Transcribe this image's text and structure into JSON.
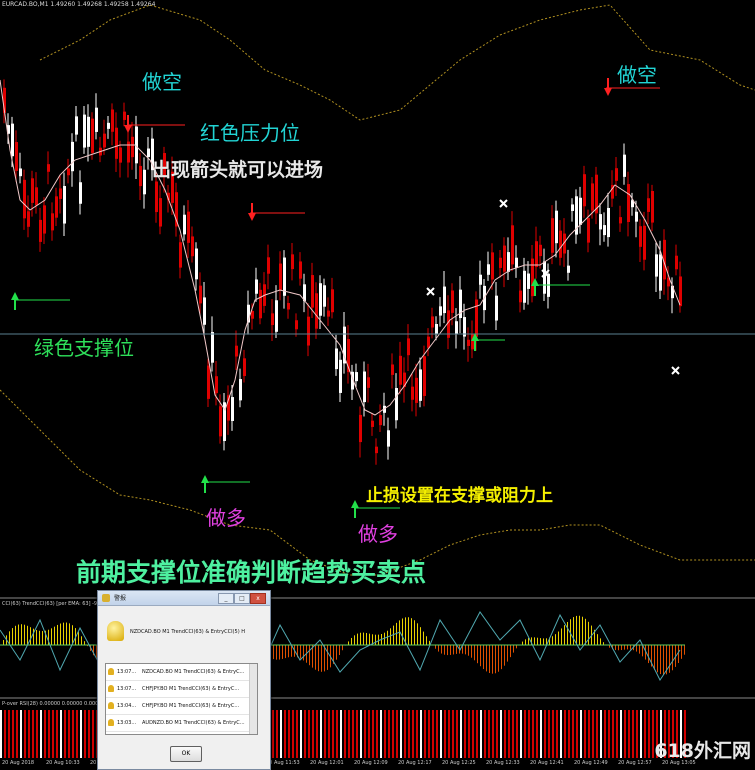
{
  "window": {
    "title": "EURCAD.BO,M1  1.49260 1.49268 1.49258 1.49264"
  },
  "annotations": {
    "sell_1": "做空",
    "red_resistance": "红色压力位",
    "arrow_entry": "出现箭头就可以进场",
    "green_support": "绿色支撑位",
    "buy_1": "做多",
    "buy_2": "做多",
    "stop_loss": "止损设置在支撑或阻力上",
    "sell_2": "做空",
    "main_caption": "前期支撑位准确判断趋势买卖点"
  },
  "indicators": {
    "cci_label": "CCI(63) TrendCCI(63) [per EMA: 63] -93.675",
    "rsi_label": "P-over RSI(28) 0.00000 0.00000 0.00000 0.00000"
  },
  "x_axis": {
    "labels": [
      "20 Aug 2018",
      "20 Aug 10:33",
      "20 Aug 10:41",
      "20 Aug 11:29",
      "20 Aug 11:37",
      "20 Aug 11:45",
      "20 Aug 11:53",
      "20 Aug 12:01",
      "20 Aug 12:09",
      "20 Aug 12:17",
      "20 Aug 12:25",
      "20 Aug 12:33",
      "20 Aug 12:41",
      "20 Aug 12:49",
      "20 Aug 12:57",
      "20 Aug 13:05"
    ]
  },
  "alert": {
    "title": "警报",
    "message": "NZDCAD.BO M1 TrendCCI(63) & EntryCCI(5) H",
    "rows": [
      {
        "time": "13:07...",
        "text": "NZDCAD.BO M1 TrendCCI(63) & EntryC..."
      },
      {
        "time": "13:07...",
        "text": "CHFJPY.BO M1 TrendCCI(63) & EntryC..."
      },
      {
        "time": "13:04...",
        "text": "CHFJPY.BO M1 TrendCCI(63) & EntryC..."
      },
      {
        "time": "13:03...",
        "text": "AUDNZD.BO M1 TrendCCI(63) & EntryC..."
      }
    ],
    "ok_label": "OK",
    "minimize": "_",
    "maximize": "□",
    "close": "x"
  },
  "watermark": "618外汇网",
  "colors": {
    "bull": "#ffffff",
    "bear": "#e00000",
    "ma": "#f0c8c8",
    "envelope": "#b09020",
    "support": "#22e04a",
    "resistance": "#ff2020"
  }
}
